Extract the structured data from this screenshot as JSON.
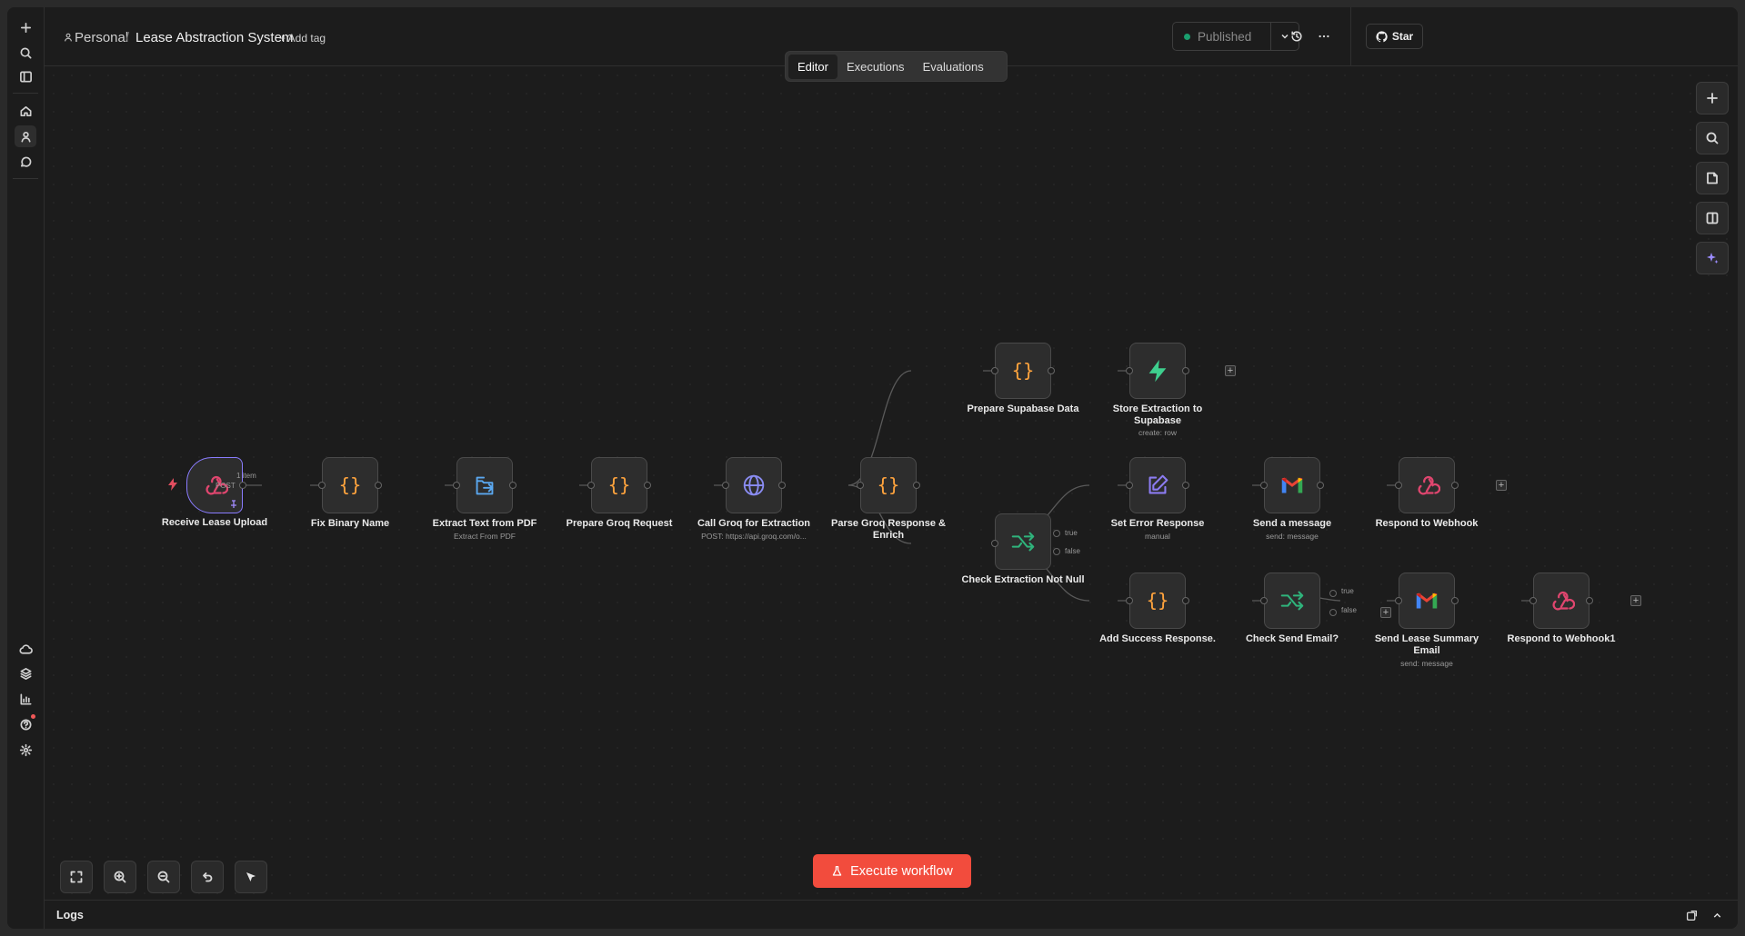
{
  "breadcrumb": {
    "project": "Personal",
    "separator": "/",
    "workflow_name": "Lease Abstraction System",
    "add_tag": "+ Add tag"
  },
  "header": {
    "status_label": "Published",
    "status_color": "#1a9e6e",
    "star_label": "Star"
  },
  "tabs": [
    {
      "label": "Editor",
      "active": true
    },
    {
      "label": "Executions",
      "active": false
    },
    {
      "label": "Evaluations",
      "active": false
    }
  ],
  "nodes": {
    "receive": {
      "label": "Receive Lease Upload",
      "edge_method": "POST",
      "edge_items": "1 item"
    },
    "fix_binary": {
      "label": "Fix Binary Name"
    },
    "extract_text": {
      "label": "Extract Text from PDF",
      "sub": "Extract From PDF"
    },
    "prepare_groq": {
      "label": "Prepare Groq Request"
    },
    "call_groq": {
      "label": "Call Groq for Extraction",
      "sub": "POST: https://api.groq.com/o..."
    },
    "parse_groq": {
      "label": "Parse Groq Response & Enrich"
    },
    "prepare_supabase": {
      "label": "Prepare Supabase Data"
    },
    "store_supabase": {
      "label": "Store Extraction to Supabase",
      "sub": "create: row"
    },
    "check_extraction": {
      "label": "Check Extraction Not Null",
      "true_label": "true",
      "false_label": "false"
    },
    "set_error": {
      "label": "Set Error Response",
      "sub": "manual"
    },
    "send_message": {
      "label": "Send a message",
      "sub": "send: message"
    },
    "respond_webhook": {
      "label": "Respond to Webhook"
    },
    "add_success": {
      "label": "Add Success Response."
    },
    "check_send_email": {
      "label": "Check Send Email?",
      "true_label": "true",
      "false_label": "false"
    },
    "send_summary": {
      "label": "Send Lease Summary Email",
      "sub": "send: message"
    },
    "respond_webhook1": {
      "label": "Respond to Webhook1"
    }
  },
  "execute_button": {
    "label": "Execute workflow",
    "color": "#f24c3d"
  },
  "logs": {
    "label": "Logs"
  },
  "icons": [
    "plus-icon",
    "search-icon",
    "sidebar-toggle-icon",
    "home-icon",
    "user-icon",
    "chat-icon",
    "cloud-icon",
    "templates-icon",
    "insights-icon",
    "help-icon",
    "settings-icon",
    "history-icon",
    "more-icon",
    "github-icon",
    "webhook-icon",
    "code-icon",
    "extract-icon",
    "http-icon",
    "supabase-icon",
    "if-icon",
    "edit-icon",
    "gmail-icon",
    "fit-view-icon",
    "zoom-in-icon",
    "zoom-out-icon",
    "undo-icon",
    "tidy-icon",
    "sticky-note-icon",
    "panel-icon",
    "ai-sparkle-icon",
    "flask-icon",
    "popout-icon",
    "chevron-up-icon"
  ]
}
